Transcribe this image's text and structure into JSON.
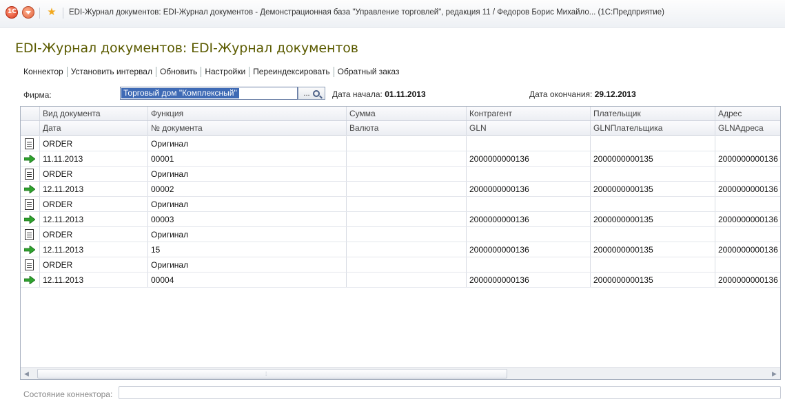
{
  "window": {
    "title": "EDI-Журнал документов: EDI-Журнал документов - Демонстрационная база \"Управление торговлей\", редакция 11 / Федоров Борис Михайло... (1С:Предприятие)",
    "logo_text": "1С"
  },
  "page": {
    "title": "EDI-Журнал документов: EDI-Журнал документов"
  },
  "toolbar": {
    "items": [
      "Коннектор",
      "Установить интервал",
      "Обновить",
      "Настройки",
      "Переиндексировать",
      "Обратный заказ"
    ]
  },
  "filters": {
    "firm_label": "Фирма:",
    "firm_value": "Торговый дом \"Комплексный\"",
    "firm_select_btn": "...",
    "start_label": "Дата начала:",
    "start_value": "01.11.2013",
    "end_label": "Дата окончания:",
    "end_value": "29.12.2013"
  },
  "table": {
    "header_top": [
      "Вид документа",
      "Функция",
      "Сумма",
      "Контрагент",
      "Плательщик",
      "Адрес"
    ],
    "header_bottom": [
      "Дата",
      "№ документа",
      "Валюта",
      "GLN",
      "GLNПлательщика",
      "GLNАдреса"
    ],
    "rows": [
      {
        "doc_type": "ORDER",
        "function": "Оригинал",
        "date": "11.11.2013",
        "number": "00001",
        "gln": "2000000000136",
        "payer_gln": "2000000000135",
        "addr_gln": "2000000000136"
      },
      {
        "doc_type": "ORDER",
        "function": "Оригинал",
        "date": "12.11.2013",
        "number": "00002",
        "gln": "2000000000136",
        "payer_gln": "2000000000135",
        "addr_gln": "2000000000136"
      },
      {
        "doc_type": "ORDER",
        "function": "Оригинал",
        "date": "12.11.2013",
        "number": "00003",
        "gln": "2000000000136",
        "payer_gln": "2000000000135",
        "addr_gln": "2000000000136"
      },
      {
        "doc_type": "ORDER",
        "function": "Оригинал",
        "date": "12.11.2013",
        "number": "15",
        "gln": "2000000000136",
        "payer_gln": "2000000000135",
        "addr_gln": "2000000000136"
      },
      {
        "doc_type": "ORDER",
        "function": "Оригинал",
        "date": "12.11.2013",
        "number": "00004",
        "gln": "2000000000136",
        "payer_gln": "2000000000135",
        "addr_gln": "2000000000136"
      }
    ]
  },
  "status": {
    "connector_label": "Состояние коннектора:",
    "connector_value": ""
  },
  "icons": {
    "doc_row": "document-icon",
    "arrow_row": "green-arrow-icon",
    "star": "favorite-star-icon",
    "search": "search-icon"
  },
  "colors": {
    "title": "#5b5b00",
    "selection": "#3e6ab5",
    "arrow": "#2ea32e"
  }
}
